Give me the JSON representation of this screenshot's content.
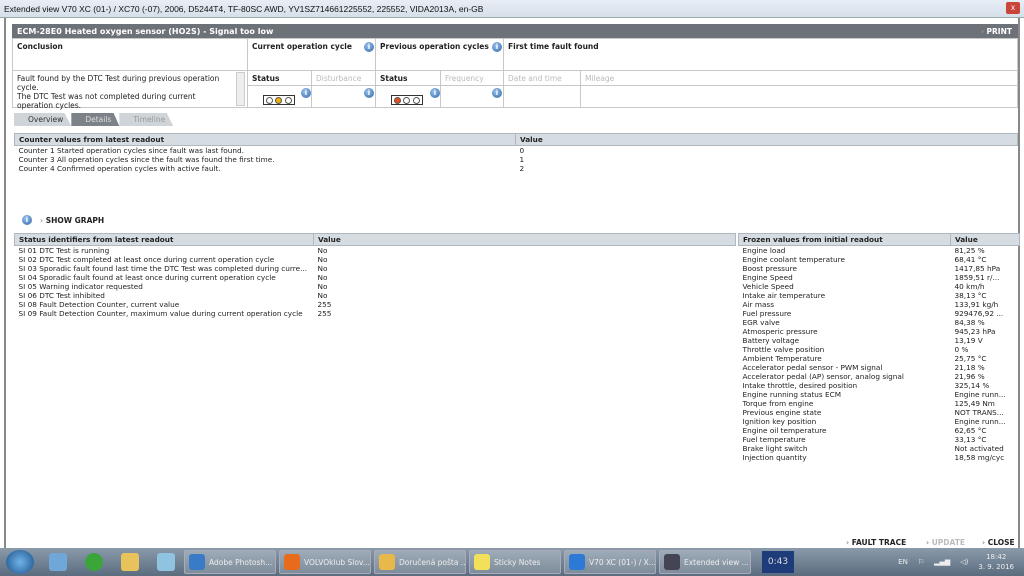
{
  "window": {
    "title": "Extended view   V70 XC (01-) / XC70 (-07), 2006, D5244T4, TF-80SC AWD, YV1SZ714661225552, 225552, VIDA2013A, en-GB",
    "close": "x"
  },
  "header": {
    "title": "ECM-28E0 Heated oxygen sensor (HO2S) - Signal too low",
    "print": "PRINT"
  },
  "dtc": {
    "conclusion_label": "Conclusion",
    "conclusion_text": "Fault found by the DTC Test during previous operation cycle.\nThe DTC Test was not completed during current operation cycles.",
    "current_cycle": "Current operation cycle",
    "previous_cycles": "Previous operation cycles",
    "first_time": "First time fault found",
    "status": "Status",
    "disturbance": "Disturbance",
    "frequency": "Frequency",
    "date_time": "Date and time",
    "mileage": "Mileage",
    "current_status_lights": [
      "off",
      "yellow",
      "off"
    ],
    "previous_status_lights": [
      "red",
      "off",
      "off"
    ],
    "colors": {
      "yellow": "#f0b400",
      "red": "#e8501e"
    }
  },
  "tabs": [
    {
      "label": "Overview"
    },
    {
      "label": "Details",
      "active": true
    },
    {
      "label": "Timeline",
      "disabled": true
    }
  ],
  "counters": {
    "header": "Counter values from latest readout",
    "value_header": "Value",
    "rows": [
      {
        "label": "Counter 1 Started operation cycles since fault was last found.",
        "value": "0"
      },
      {
        "label": "Counter 3 All operation cycles since the fault was found the first time.",
        "value": "1"
      },
      {
        "label": "Counter 4 Confirmed operation cycles with active fault.",
        "value": "2"
      }
    ]
  },
  "show_graph": "SHOW GRAPH",
  "status_ids": {
    "header": "Status identifiers from latest readout",
    "value_header": "Value",
    "rows": [
      {
        "label": "SI 01 DTC Test is running",
        "value": "No"
      },
      {
        "label": "SI 02 DTC Test completed at least once during current operation cycle",
        "value": "No"
      },
      {
        "label": "SI 03 Sporadic fault found last time the DTC Test was completed during curre...",
        "value": "No"
      },
      {
        "label": "SI 04 Sporadic fault found at least once during current operation cycle",
        "value": "No"
      },
      {
        "label": "SI 05 Warning indicator requested",
        "value": "No"
      },
      {
        "label": "SI 06 DTC Test inhibited",
        "value": "No"
      },
      {
        "label": "SI 08 Fault Detection Counter, current value",
        "value": "255"
      },
      {
        "label": "SI 09 Fault Detection Counter, maximum value during current operation cycle",
        "value": "255"
      }
    ]
  },
  "frozen": {
    "header": "Frozen values from initial readout",
    "value_header": "Value",
    "rows": [
      {
        "label": "Engine load",
        "value": "81,25 %"
      },
      {
        "label": "Engine coolant temperature",
        "value": "68,41 °C"
      },
      {
        "label": "Boost pressure",
        "value": "1417,85 hPa"
      },
      {
        "label": "Engine Speed",
        "value": "1859,51 r/..."
      },
      {
        "label": "Vehicle Speed",
        "value": "40 km/h"
      },
      {
        "label": "Intake air temperature",
        "value": "38,13 °C"
      },
      {
        "label": "Air mass",
        "value": "133,91 kg/h"
      },
      {
        "label": "Fuel pressure",
        "value": "929476,92 ..."
      },
      {
        "label": "EGR valve",
        "value": "84,38 %"
      },
      {
        "label": "Atmosperic pressure",
        "value": "945,23 hPa"
      },
      {
        "label": "Battery voltage",
        "value": "13,19 V"
      },
      {
        "label": "Throttle valve position",
        "value": "0 %"
      },
      {
        "label": "Ambient Temperature",
        "value": "25,75 °C"
      },
      {
        "label": "Accelerator pedal sensor - PWM signal",
        "value": "21,18 %"
      },
      {
        "label": "Accelerator pedal (AP) sensor, analog signal",
        "value": "21,96 %"
      },
      {
        "label": "Intake throttle, desired position",
        "value": "325,14 %"
      },
      {
        "label": "Engine running status ECM",
        "value": "Engine runn..."
      },
      {
        "label": "Torque from engine",
        "value": "125,49 Nm"
      },
      {
        "label": "Previous engine state",
        "value": "NOT TRANS..."
      },
      {
        "label": "Ignition key position",
        "value": "Engine runn..."
      },
      {
        "label": "Engine oil temperature",
        "value": "62,65 °C"
      },
      {
        "label": "Fuel temperature",
        "value": "33,13 °C"
      },
      {
        "label": "Brake light switch",
        "value": "Not activated"
      },
      {
        "label": "Injection quantity",
        "value": "18,58 mg/cyc"
      }
    ]
  },
  "footer": {
    "fault_trace": "FAULT TRACE",
    "update": "UPDATE",
    "close": "CLOSE"
  },
  "taskbar": {
    "items": [
      {
        "label": "Adobe Photosh...",
        "color": "#3a7bc8"
      },
      {
        "label": "VOLVOklub Slov...",
        "color": "#e86a1c"
      },
      {
        "label": "Doručená pošta ...",
        "color": "#e8b84a"
      },
      {
        "label": "Sticky Notes",
        "color": "#f2e05a"
      },
      {
        "label": "V70 XC (01-) / X...",
        "color": "#2c7ad6"
      },
      {
        "label": "Extended view ...",
        "color": "#445"
      }
    ],
    "timer": "0:43",
    "lang": "EN",
    "time": "18:42",
    "date": "3. 9. 2016"
  }
}
